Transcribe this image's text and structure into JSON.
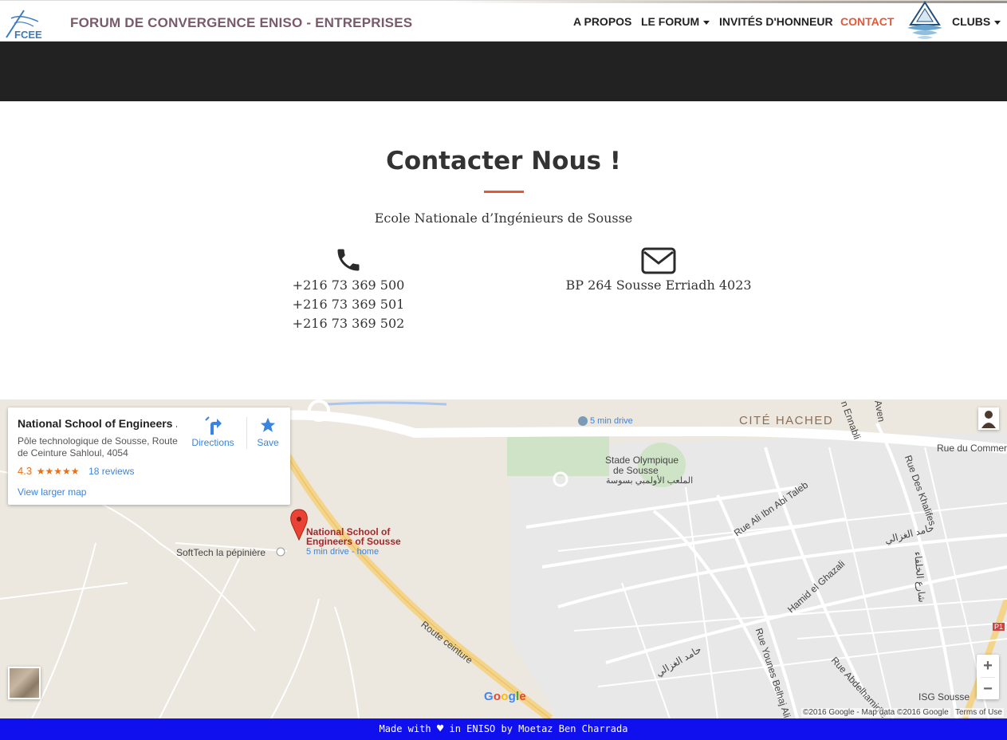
{
  "navbar": {
    "brand": "FORUM DE CONVERGENCE ENISO - ENTREPRISES",
    "logo_text": "FCEE",
    "items": [
      {
        "label": "A PROPOS",
        "dropdown": false,
        "active": false
      },
      {
        "label": "LE FORUM",
        "dropdown": true,
        "active": false
      },
      {
        "label": "INVITÉS D'HONNEUR",
        "dropdown": false,
        "active": false
      },
      {
        "label": "CONTACT",
        "dropdown": false,
        "active": true
      },
      {
        "label": "CLUBS",
        "dropdown": true,
        "active": false
      }
    ],
    "accent": "#e05a3a"
  },
  "contact": {
    "title": "Contacter Nous !",
    "school": "Ecole Nationale d’Ingénieurs de Sousse",
    "phone_icon": "phone-icon",
    "phones": [
      "+216 73 369 500",
      "+216 73 369 501",
      "+216 73 369 502"
    ],
    "mail_icon": "envelope-icon",
    "address": "BP 264 Sousse Erriadh 4023"
  },
  "map": {
    "card": {
      "title": "National School of Engineers ...",
      "address": "Pôle technologique de Sousse, Route de Ceinture Sahloul, 4054",
      "rating": "4.3",
      "stars": "★★★★★",
      "reviews": "18 reviews",
      "larger_map": "View larger map",
      "directions": "Directions",
      "save": "Save"
    },
    "labels": {
      "drive_top": "5 min drive",
      "cite": "CITÉ HACHED",
      "stade_1": "Stade Olympique",
      "stade_2": "de Sousse",
      "stade_ar": "الملعب الأولمبي بسوسة",
      "softtech": "SoftTech la pépinière",
      "pin_1": "National School of",
      "pin_2": "Engineers of Sousse",
      "pin_sub": "5 min drive - home",
      "route": "Route ceinture",
      "ibn_abi": "Rue Ali Ibn Abi Taleb",
      "ghazali": "Hamid el Ghazali",
      "ghazali_ar": "حامد الغزالي",
      "ghazali_ar2": "حامد الغزالي",
      "khalifes": "Rue Des Khalifes",
      "khalifes_ar": "شارع الخلفاء",
      "commerce": "Rue du Commerce",
      "ennabli": "n Ennabli",
      "aven": "Aven",
      "younes": "Rue Younes Belhaj Ali",
      "abdelhamid": "Rue Abdelhamid e",
      "isg": "ISG Sousse",
      "p1": "P1"
    },
    "zoom_in": "+",
    "zoom_out": "−",
    "google": "Google",
    "copyright": "©2016 Google - Map data ©2016 Google",
    "terms": "Terms of Use"
  },
  "footer": {
    "made_with": "Made with",
    "heart": "♥",
    "rest": "in ENISO by Moetaz Ben Charrada"
  }
}
